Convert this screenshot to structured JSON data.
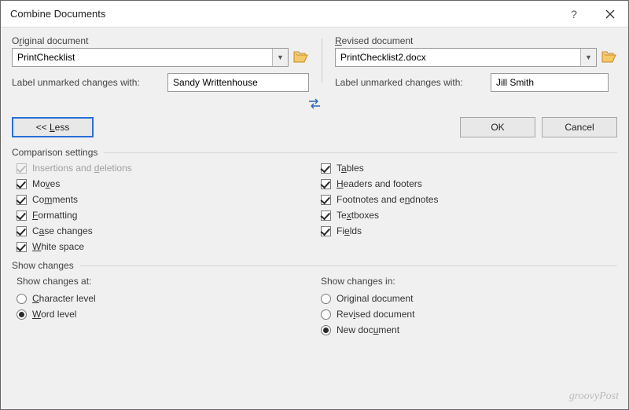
{
  "window": {
    "title": "Combine Documents"
  },
  "original": {
    "label_pre": "O",
    "label_under": "r",
    "label_post": "iginal document",
    "value": "PrintChecklist",
    "unmarked_label": "Label unmarked changes with:",
    "unmarked_value": "Sandy Writtenhouse"
  },
  "revised": {
    "label_pre": "",
    "label_under": "R",
    "label_post": "evised document",
    "value": "PrintChecklist2.docx",
    "unmarked_label": "Label unmarked changes with:",
    "unmarked_value": "Jill Smith"
  },
  "buttons": {
    "less": "<< Less",
    "ok": "OK",
    "cancel": "Cancel"
  },
  "comparison": {
    "title": "Comparison settings",
    "left": [
      {
        "label_pre": "Insertions and ",
        "under": "d",
        "label_post": "eletions",
        "checked": true,
        "disabled": true
      },
      {
        "label_pre": "Mo",
        "under": "v",
        "label_post": "es",
        "checked": true,
        "disabled": false
      },
      {
        "label_pre": "Co",
        "under": "m",
        "label_post": "ments",
        "checked": true,
        "disabled": false
      },
      {
        "label_pre": "",
        "under": "F",
        "label_post": "ormatting",
        "checked": true,
        "disabled": false
      },
      {
        "label_pre": "C",
        "under": "a",
        "label_post": "se changes",
        "checked": true,
        "disabled": false
      },
      {
        "label_pre": "",
        "under": "W",
        "label_post": "hite space",
        "checked": true,
        "disabled": false
      }
    ],
    "right": [
      {
        "label_pre": "T",
        "under": "a",
        "label_post": "bles",
        "checked": true,
        "disabled": false
      },
      {
        "label_pre": "",
        "under": "H",
        "label_post": "eaders and footers",
        "checked": true,
        "disabled": false
      },
      {
        "label_pre": "Footnotes and e",
        "under": "n",
        "label_post": "dnotes",
        "checked": true,
        "disabled": false
      },
      {
        "label_pre": "Te",
        "under": "x",
        "label_post": "tboxes",
        "checked": true,
        "disabled": false
      },
      {
        "label_pre": "Fi",
        "under": "e",
        "label_post": "lds",
        "checked": true,
        "disabled": false
      }
    ]
  },
  "show": {
    "title": "Show changes",
    "at_heading": "Show changes at:",
    "at": [
      {
        "label_pre": "",
        "under": "C",
        "label_post": "haracter level",
        "selected": false
      },
      {
        "label_pre": "",
        "under": "W",
        "label_post": "ord level",
        "selected": true
      }
    ],
    "in_heading": "Show changes in:",
    "in": [
      {
        "label_pre": "Ori",
        "under": "g",
        "label_post": "inal document",
        "selected": false
      },
      {
        "label_pre": "Rev",
        "under": "i",
        "label_post": "sed document",
        "selected": false
      },
      {
        "label_pre": "New doc",
        "under": "u",
        "label_post": "ment",
        "selected": true
      }
    ]
  },
  "watermark": "groovyPost"
}
